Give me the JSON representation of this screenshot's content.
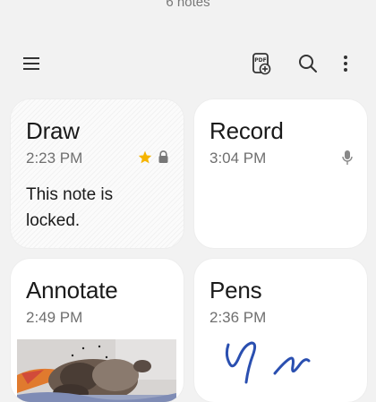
{
  "header": {
    "note_count": "6 notes"
  },
  "toolbar": {
    "icons": [
      "menu-icon",
      "pdf-add-icon",
      "search-icon",
      "more-vert-icon"
    ]
  },
  "notes": [
    {
      "title": "Draw",
      "time": "2:23 PM",
      "body": "This note is locked.",
      "favorite": true,
      "locked": true
    },
    {
      "title": "Record",
      "time": "3:04 PM",
      "has_audio": true
    },
    {
      "title": "Annotate",
      "time": "2:49 PM",
      "has_image": true
    },
    {
      "title": "Pens",
      "time": "2:36 PM",
      "has_drawing": true
    }
  ],
  "colors": {
    "background": "#f2f2f2",
    "card": "#ffffff",
    "star": "#f5b400",
    "ink": "#2a4fb0"
  }
}
